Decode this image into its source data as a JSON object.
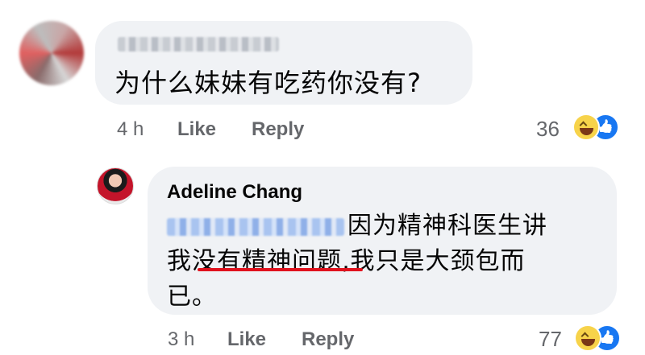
{
  "comment1": {
    "text": "为什么妹妹有吃药你没有?",
    "time": "4 h",
    "like_label": "Like",
    "reply_label": "Reply",
    "reaction_count": "36",
    "reactions": [
      "haha-icon",
      "like-icon"
    ]
  },
  "reply": {
    "author": "Adeline Chang",
    "line1": "因为精神科医生讲",
    "line2_prefix": "我",
    "line2_underlined": "没有精神问题",
    "line2_suffix": ",我只是大颈包而",
    "line3": "已。",
    "time": "3 h",
    "like_label": "Like",
    "reply_label": "Reply",
    "reaction_count": "77",
    "reactions": [
      "haha-icon",
      "like-icon"
    ]
  },
  "colors": {
    "bubble": "#f0f2f5",
    "meta_text": "#65676b",
    "like_blue": "#1877f2",
    "haha_yellow": "#f7d34a",
    "underline_red": "#e0121d"
  }
}
